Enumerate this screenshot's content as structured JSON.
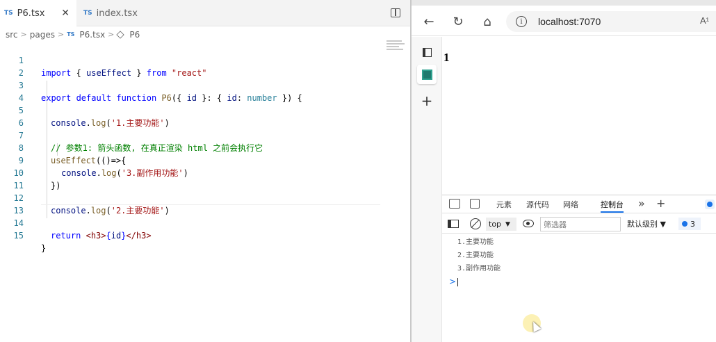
{
  "editor": {
    "tabs": [
      {
        "badge": "TS",
        "label": "P6.tsx",
        "close": "✕",
        "active": true
      },
      {
        "badge": "TS",
        "label": "index.tsx",
        "active": false
      }
    ],
    "breadcrumb": {
      "src": "src",
      "pages": "pages",
      "file_badge": "TS",
      "file": "P6.tsx",
      "symbol": "P6",
      "sep": ">"
    },
    "lines": [
      {
        "n": "1"
      },
      {
        "n": "2"
      },
      {
        "n": "3"
      },
      {
        "n": "4"
      },
      {
        "n": "5"
      },
      {
        "n": "6"
      },
      {
        "n": "7"
      },
      {
        "n": "8"
      },
      {
        "n": "9"
      },
      {
        "n": "10"
      },
      {
        "n": "11"
      },
      {
        "n": "12"
      },
      {
        "n": "13"
      },
      {
        "n": "14"
      },
      {
        "n": "15"
      }
    ],
    "code": {
      "l1": {
        "import": "import",
        "b1": " { ",
        "useEffect": "useEffect",
        "b2": " } ",
        "from": "from",
        "sp": " ",
        "mod": "\"react\""
      },
      "l3": {
        "export": "export",
        "default": " default ",
        "function": "function",
        "name": " P6",
        "p1": "({ ",
        "id": "id",
        "p2": " }: { ",
        "id2": "id",
        "p3": ": ",
        "number": "number",
        "p4": " }) {"
      },
      "l5": {
        "console": "console",
        "dot": ".",
        "log": "log",
        "p1": "(",
        "str": "'1.主要功能'",
        "p2": ")"
      },
      "l7": {
        "comment": "// 参数1: 箭头函数, 在真正渲染 html 之前会执行它"
      },
      "l8": {
        "fn": "useEffect",
        "rest": "(()=>{"
      },
      "l9": {
        "console": "console",
        "dot": ".",
        "log": "log",
        "p1": "(",
        "str": "'3.副作用功能'",
        "p2": ")"
      },
      "l10": {
        "text": "})"
      },
      "l12": {
        "console": "console",
        "dot": ".",
        "log": "log",
        "p1": "(",
        "str": "'2.主要功能'",
        "p2": ")"
      },
      "l14": {
        "ret": "return",
        "sp": " ",
        "open": "<h3>",
        "expr1": "{",
        "id": "id",
        "expr2": "}",
        "close": "</h3>"
      },
      "l15": {
        "text": "}"
      }
    }
  },
  "browser": {
    "address": "localhost:7070",
    "info_glyph": "i",
    "reader_glyph": "A¹",
    "nav": {
      "back": "←",
      "reload": "↻",
      "home": "⌂"
    },
    "vertical_tabs": {
      "new_tab": "+"
    },
    "page": {
      "h3": "1"
    }
  },
  "devtools": {
    "tabs": {
      "elements": "元素",
      "sources": "源代码",
      "network": "网络",
      "console": "控制台",
      "more": "»",
      "add": "+"
    },
    "toolbar": {
      "context": "top",
      "caret": "▼",
      "filter_placeholder": "筛选器",
      "level": "默认级别 ▼",
      "issues": "3"
    },
    "console_logs": [
      "1.主要功能",
      "2.主要功能",
      "3.副作用功能"
    ],
    "prompt": ">"
  },
  "colors": {
    "keyword": "#0000ff",
    "string": "#a31515",
    "comment": "#008000",
    "accent": "#1a73e8"
  }
}
